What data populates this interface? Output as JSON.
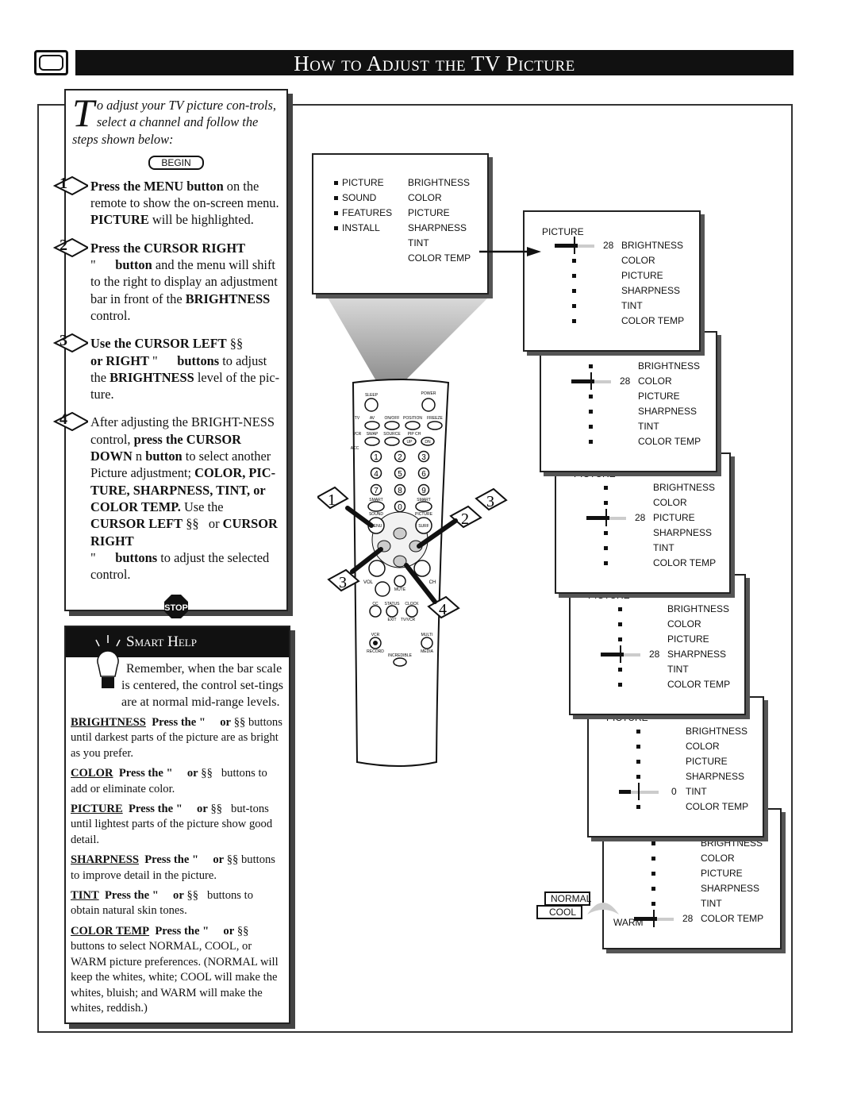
{
  "header": {
    "title": "How to Adjust the TV Picture",
    "icon": "tv-icon"
  },
  "intro": {
    "dropcap": "T",
    "text": "o adjust your TV picture con-trols, select a channel and follow the steps shown below:",
    "begin": "BEGIN"
  },
  "steps": [
    {
      "num": "1",
      "bold": "Press the MENU button",
      "rest": " on the remote to show the on-screen menu. ",
      "bold2": "PICTURE",
      "rest2": " will be highlighted."
    },
    {
      "num": "2",
      "html": "<b>Press the CURSOR RIGHT</b><br>\"&nbsp;&nbsp;&nbsp;&nbsp;&nbsp; <b>button</b> and the menu will shift to the right to display an adjustment bar in front of the <b>BRIGHTNESS</b> control."
    },
    {
      "num": "3",
      "html": "<b>Use the CURSOR LEFT</b> §§<br><b>or RIGHT</b> \"&nbsp;&nbsp;&nbsp;&nbsp;&nbsp; <b>buttons</b> to adjust the <b>BRIGHTNESS</b> level of the pic-ture."
    },
    {
      "num": "4",
      "html": "After adjusting the BRIGHT-NESS control, <b>press the CURSOR DOWN</b> n <b>button</b> to select another Picture adjustment; <b>COLOR, PIC-TURE, SHARPNESS, TINT, or COLOR TEMP.</b> Use the <b>CURSOR LEFT</b> §§&nbsp;&nbsp; or <b>CURSOR RIGHT</b><br>\"&nbsp;&nbsp;&nbsp;&nbsp;&nbsp; <b>buttons</b> to adjust the selected control."
    }
  ],
  "stop_label": "STOP",
  "smart_help": {
    "title": "Smart Help",
    "intro": "Remember, when the bar scale is centered, the control set-tings are at normal mid-range levels.",
    "items": [
      {
        "term": "BRIGHTNESS",
        "text": "<b>Press the \"&nbsp;&nbsp;&nbsp;&nbsp; or</b> §§ buttons until darkest parts of the picture are as bright as you prefer."
      },
      {
        "term": "COLOR",
        "text": "<b>Press the \"&nbsp;&nbsp;&nbsp;&nbsp; or</b> §§&nbsp;&nbsp; buttons to add or eliminate color."
      },
      {
        "term": "PICTURE",
        "text": "<b>Press the \"&nbsp;&nbsp;&nbsp;&nbsp; or</b> §§&nbsp;&nbsp; but-tons until lightest parts of the picture show good detail."
      },
      {
        "term": "SHARPNESS",
        "text": "<b>Press the \"&nbsp;&nbsp;&nbsp;&nbsp; or</b> §§ buttons to improve detail in the picture."
      },
      {
        "term": "TINT",
        "text": "<b>Press the \"&nbsp;&nbsp;&nbsp;&nbsp; or</b> §§&nbsp;&nbsp; buttons to obtain natural skin tones."
      },
      {
        "term": "COLOR TEMP",
        "text": "<b>Press the \"&nbsp;&nbsp;&nbsp;&nbsp; or</b> §§ buttons to select NORMAL, COOL, or WARM picture preferences. (NORMAL will keep the whites, white; COOL will make the whites, bluish; and WARM will make the whites, reddish.)"
      }
    ]
  },
  "main_menu": {
    "left": [
      "PICTURE",
      "SOUND",
      "FEATURES",
      "INSTALL"
    ],
    "right": [
      "BRIGHTNESS",
      "COLOR",
      "PICTURE",
      "SHARPNESS",
      "TINT",
      "COLOR TEMP"
    ]
  },
  "picture_menus": {
    "title": "PICTURE",
    "items": [
      "BRIGHTNESS",
      "COLOR",
      "PICTURE",
      "SHARPNESS",
      "TINT",
      "COLOR TEMP"
    ],
    "screens": [
      {
        "selected": 0,
        "value": "28"
      },
      {
        "selected": 1,
        "value": "28"
      },
      {
        "selected": 2,
        "value": "28"
      },
      {
        "selected": 3,
        "value": "28"
      },
      {
        "selected": 4,
        "value": "0"
      },
      {
        "selected": 5,
        "value": "28"
      }
    ]
  },
  "color_temp_options": {
    "warm": "WARM",
    "normal": "NORMAL",
    "cool": "COOL"
  },
  "remote": {
    "labels": {
      "sleep": "SLEEP",
      "power": "POWER",
      "tv": "TV",
      "vcr": "VCR",
      "acc": "ACC",
      "av": "AV",
      "onoff": "ON/OFF",
      "position": "POSITION",
      "freeze": "FREEZE",
      "swap": "SWAP",
      "source": "SOURCE",
      "pipch": "PIP CH",
      "up": "UP",
      "dn": "DN",
      "smart_sound": "SMART",
      "sound": "SOUND",
      "smart_picture": "SMART",
      "picture": "PICTURE",
      "menu": "MENU",
      "surf": "SURF",
      "vol": "VOL",
      "ch": "CH",
      "mute": "MUTE",
      "cc": "CC",
      "status": "STATUS",
      "clock": "CLOCK",
      "exit": "EXIT",
      "tvvcr": "TV/VCR",
      "vcr_record": "VCR",
      "record": "RECORD",
      "multi": "MULTI",
      "media": "MEDIA",
      "incredible": "INCREDIBLE"
    },
    "digits": [
      "1",
      "2",
      "3",
      "4",
      "5",
      "6",
      "7",
      "8",
      "9",
      "0"
    ],
    "callouts": [
      "1",
      "2",
      "3",
      "3",
      "4"
    ]
  }
}
